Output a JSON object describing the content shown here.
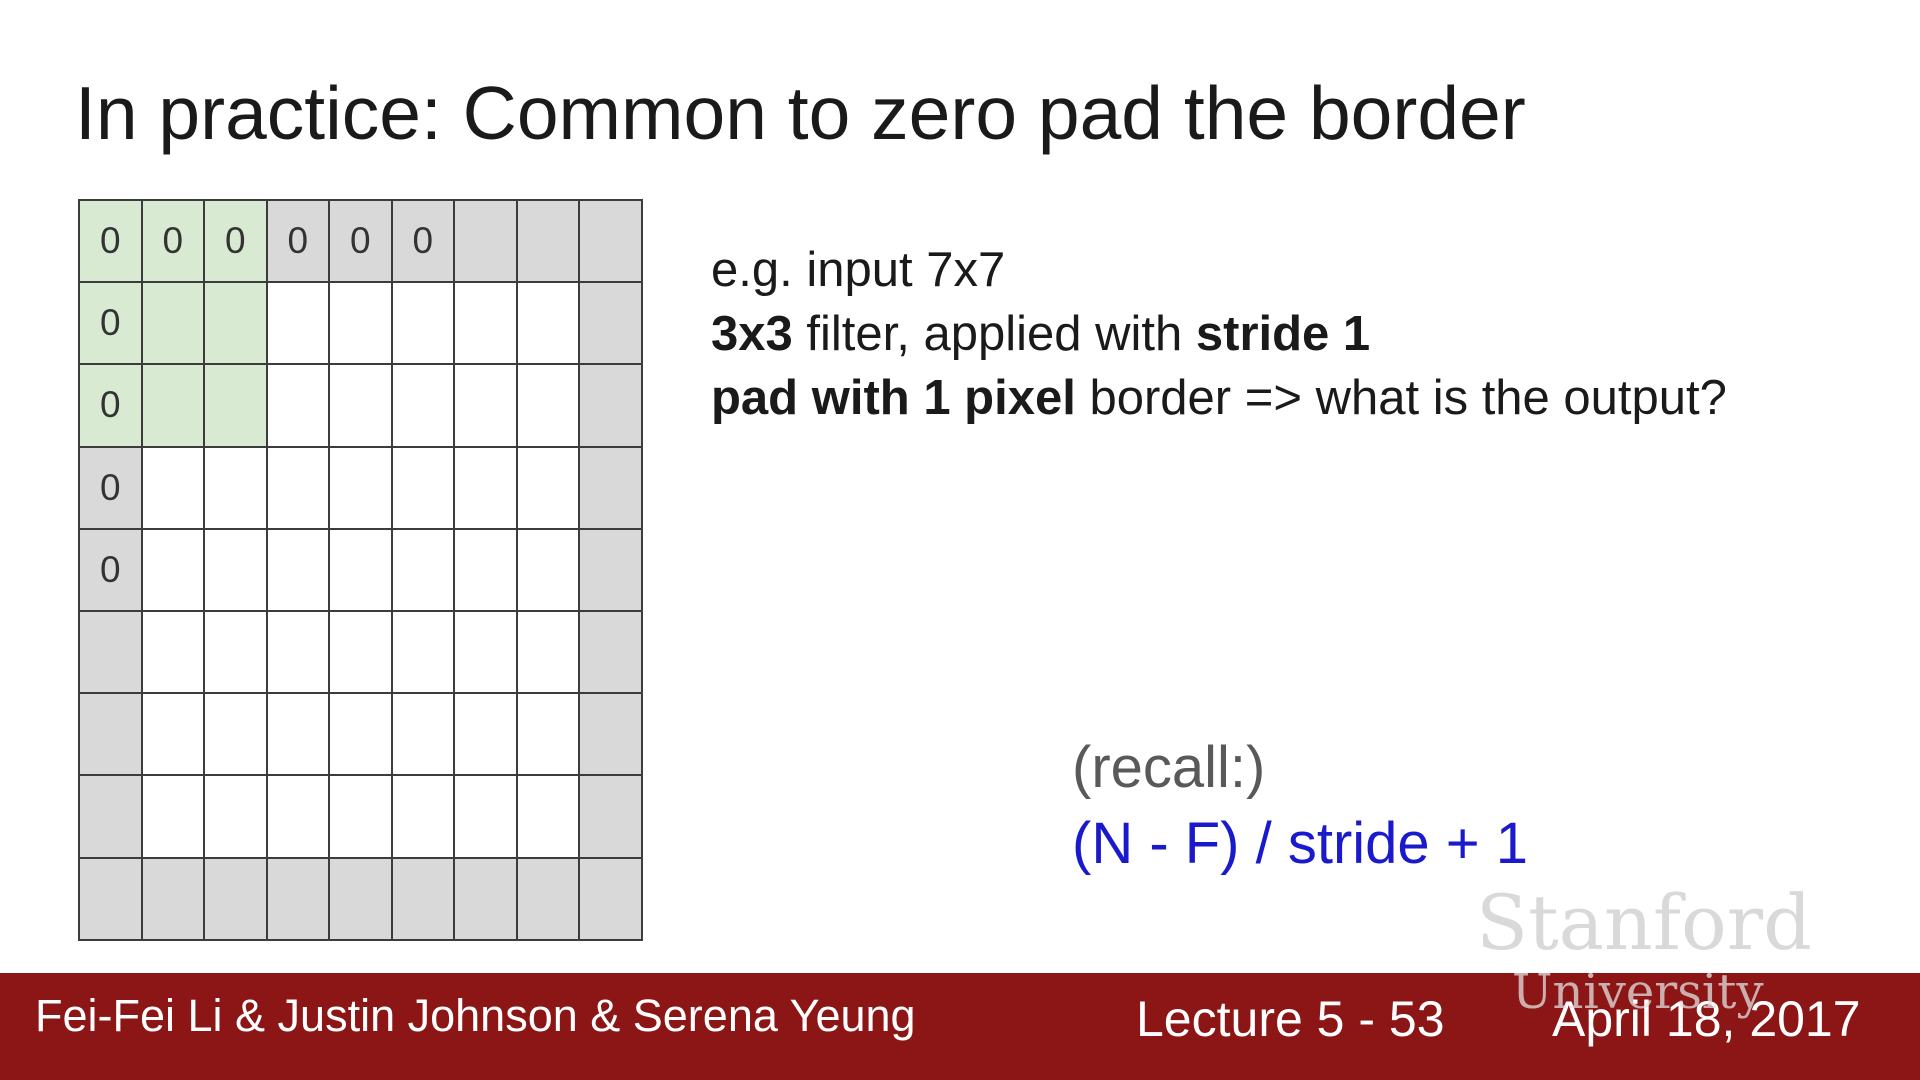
{
  "slide": {
    "title": "In practice: Common to zero pad the border",
    "description": {
      "line1": "e.g. input 7x7",
      "line2_bold": "3x3",
      "line2_rest": " filter, applied with ",
      "line2_bold2": "stride 1",
      "line3_bold": "pad with 1 pixel",
      "line3_rest": " border => what is the output?"
    },
    "recall": {
      "label": "(recall:)",
      "formula": "(N - F) / stride + 1"
    }
  },
  "grid": {
    "rows": 9,
    "cols": 9,
    "zero_label": "0",
    "top_row_zero_count": 6,
    "left_col_zero_count": 5,
    "filter_size": 3,
    "colors": {
      "padding": "#d9d9d9",
      "filter": "#d9ead3",
      "input": "#ffffff"
    }
  },
  "footer": {
    "authors": "Fei-Fei Li & Justin Johnson & Serena Yeung",
    "lecture": "Lecture 5 - 53",
    "date": "April 18, 2017",
    "color": "#8c1515"
  },
  "watermark": {
    "line1": "Stanford",
    "line2": "University"
  }
}
